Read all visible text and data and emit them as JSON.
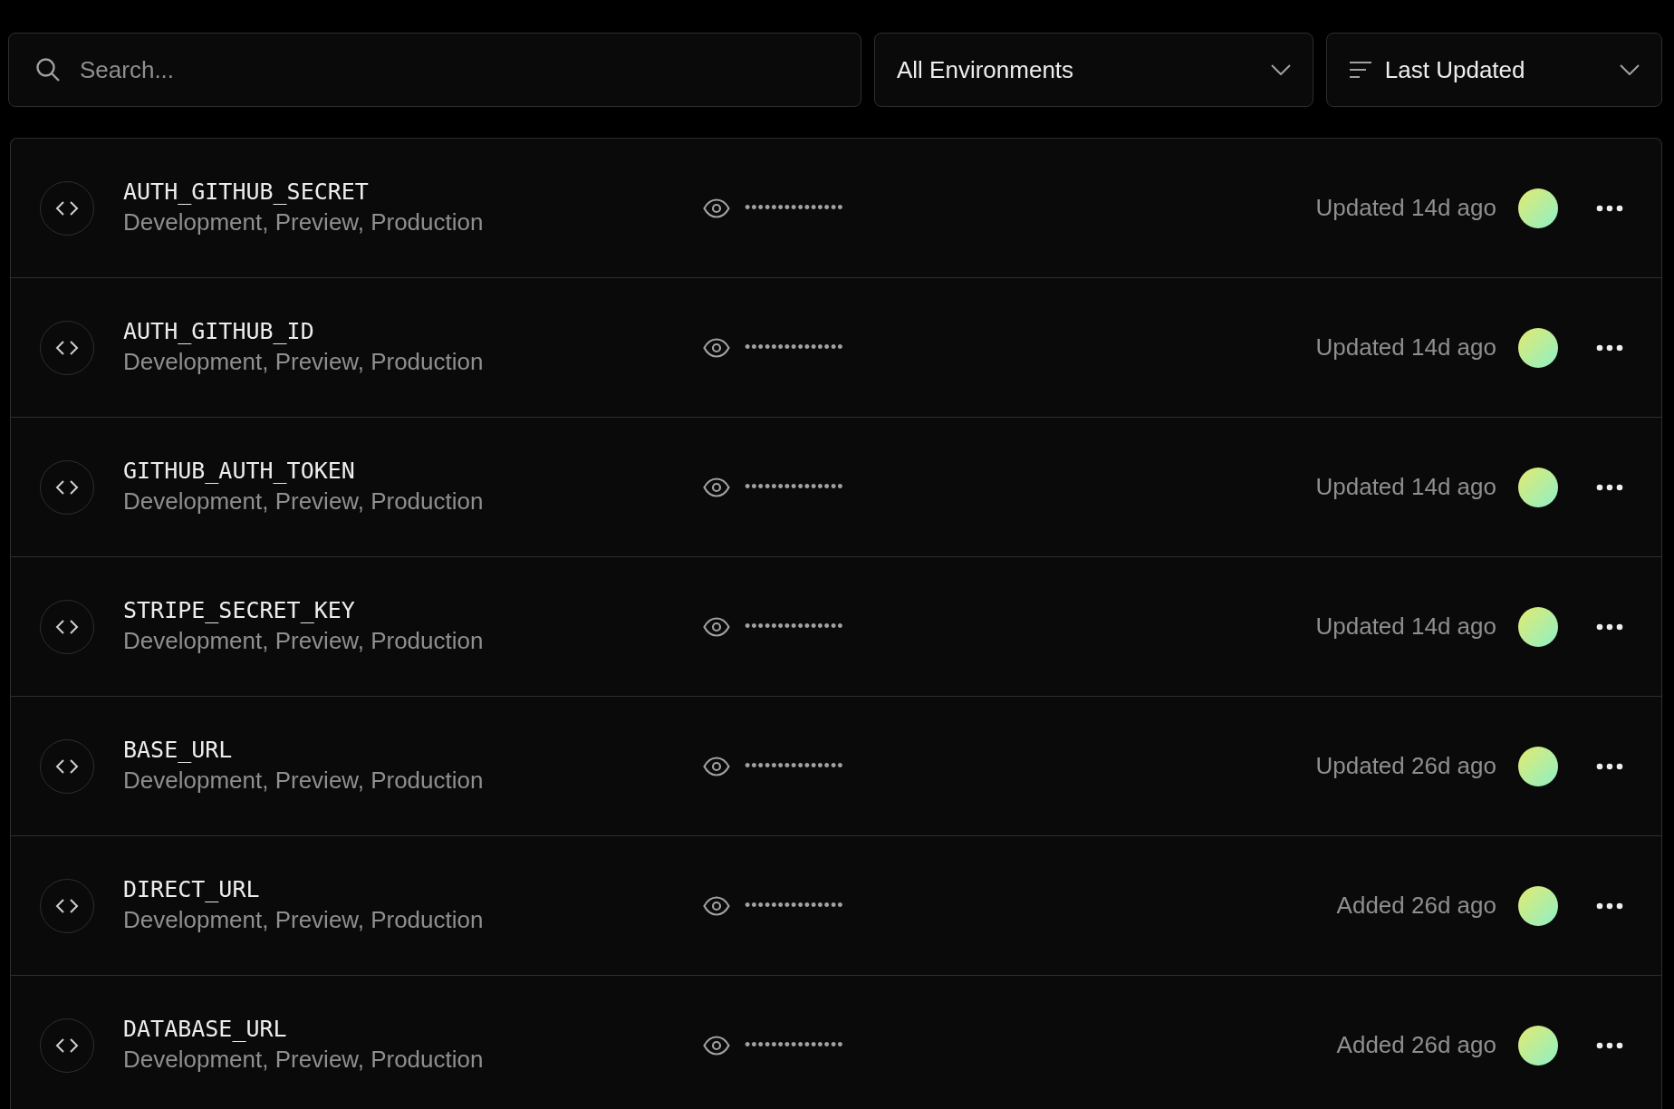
{
  "toolbar": {
    "search": {
      "placeholder": "Search..."
    },
    "environment_filter": "All Environments",
    "sort": "Last Updated"
  },
  "variables": [
    {
      "name": "AUTH_GITHUB_SECRET",
      "environments": "Development, Preview, Production",
      "value": "•••••••••••••••",
      "updated": "Updated 14d ago"
    },
    {
      "name": "AUTH_GITHUB_ID",
      "environments": "Development, Preview, Production",
      "value": "•••••••••••••••",
      "updated": "Updated 14d ago"
    },
    {
      "name": "GITHUB_AUTH_TOKEN",
      "environments": "Development, Preview, Production",
      "value": "•••••••••••••••",
      "updated": "Updated 14d ago"
    },
    {
      "name": "STRIPE_SECRET_KEY",
      "environments": "Development, Preview, Production",
      "value": "•••••••••••••••",
      "updated": "Updated 14d ago"
    },
    {
      "name": "BASE_URL",
      "environments": "Development, Preview, Production",
      "value": "•••••••••••••••",
      "updated": "Updated 26d ago"
    },
    {
      "name": "DIRECT_URL",
      "environments": "Development, Preview, Production",
      "value": "•••••••••••••••",
      "updated": "Added 26d ago"
    },
    {
      "name": "DATABASE_URL",
      "environments": "Development, Preview, Production",
      "value": "•••••••••••••••",
      "updated": "Added 26d ago"
    }
  ]
}
